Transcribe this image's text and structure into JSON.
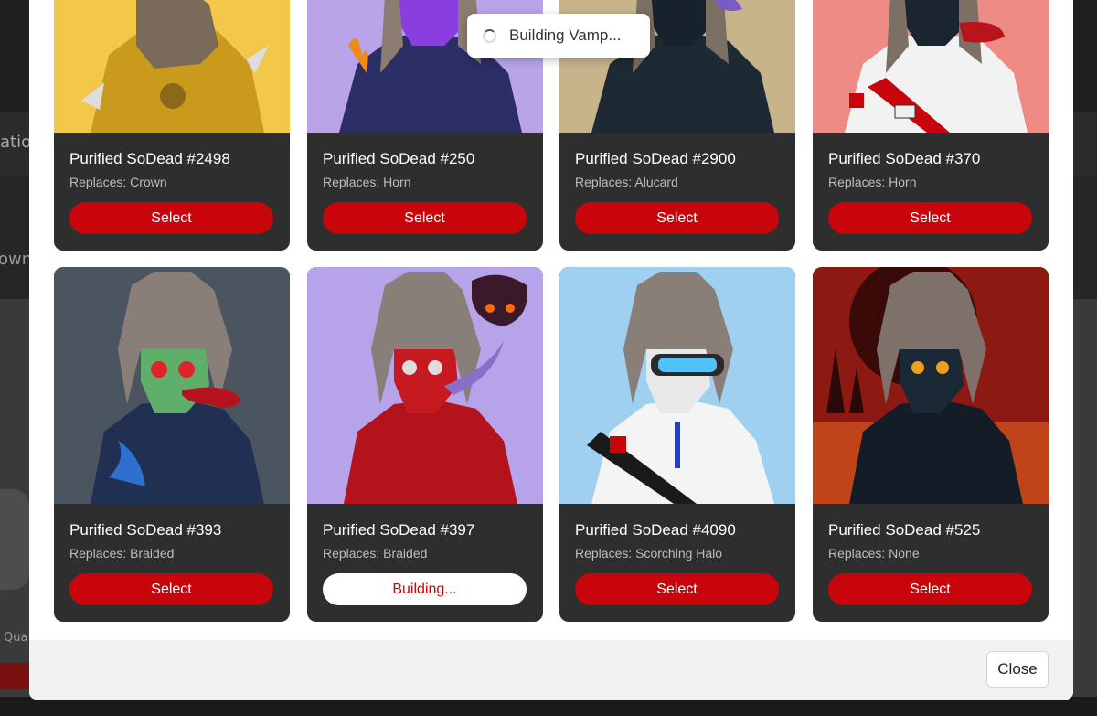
{
  "background": {
    "nav_fragment": "atio",
    "side_fragment": "own",
    "bottom_fragment": "Qua"
  },
  "toast": {
    "text": "Building Vamp..."
  },
  "cards": [
    {
      "title": "Purified SoDead #2498",
      "replaces": "Replaces: Crown",
      "button": "Select",
      "state": "idle"
    },
    {
      "title": "Purified SoDead #250",
      "replaces": "Replaces: Horn",
      "button": "Select",
      "state": "idle"
    },
    {
      "title": "Purified SoDead #2900",
      "replaces": "Replaces: Alucard",
      "button": "Select",
      "state": "idle"
    },
    {
      "title": "Purified SoDead #370",
      "replaces": "Replaces: Horn",
      "button": "Select",
      "state": "idle"
    },
    {
      "title": "Purified SoDead #393",
      "replaces": "Replaces: Braided",
      "button": "Select",
      "state": "idle"
    },
    {
      "title": "Purified SoDead #397",
      "replaces": "Replaces: Braided",
      "button": "Building...",
      "state": "building"
    },
    {
      "title": "Purified SoDead #4090",
      "replaces": "Replaces: Scorching Halo",
      "button": "Select",
      "state": "idle"
    },
    {
      "title": "Purified SoDead #525",
      "replaces": "Replaces: None",
      "button": "Select",
      "state": "idle"
    }
  ],
  "footer": {
    "close_label": "Close"
  },
  "colors": {
    "accent": "#c8050b",
    "card_bg": "#2f2e2e",
    "footer_bg": "#f1f2f4"
  }
}
